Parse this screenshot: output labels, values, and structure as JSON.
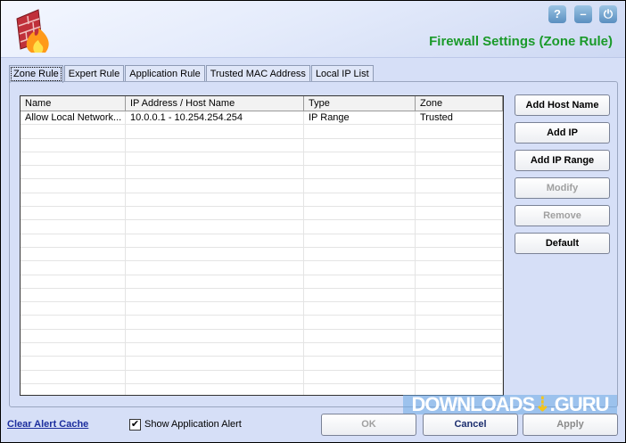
{
  "header": {
    "title": "Firewall Settings (Zone Rule)",
    "help": "?",
    "minimize": "–",
    "power": "⏻"
  },
  "tabs": [
    "Zone Rule",
    "Expert Rule",
    "Application Rule",
    "Trusted MAC Address",
    "Local IP List"
  ],
  "table": {
    "columns": [
      "Name",
      "IP Address / Host Name",
      "Type",
      "Zone"
    ],
    "rows": [
      [
        "Allow Local Network...",
        "10.0.0.1 - 10.254.254.254",
        "IP Range",
        "Trusted"
      ]
    ]
  },
  "buttons": {
    "add_host": "Add Host Name",
    "add_ip": "Add IP",
    "add_ip_range": "Add IP Range",
    "modify": "Modify",
    "remove": "Remove",
    "default": "Default"
  },
  "footer": {
    "clear_cache": "Clear Alert Cache",
    "show_alert": "Show Application Alert",
    "show_alert_checked": true,
    "ok": "OK",
    "cancel": "Cancel",
    "apply": "Apply"
  },
  "watermark": {
    "left": "DOWNLOADS",
    "mark": "⇣",
    "right": ".GURU"
  }
}
